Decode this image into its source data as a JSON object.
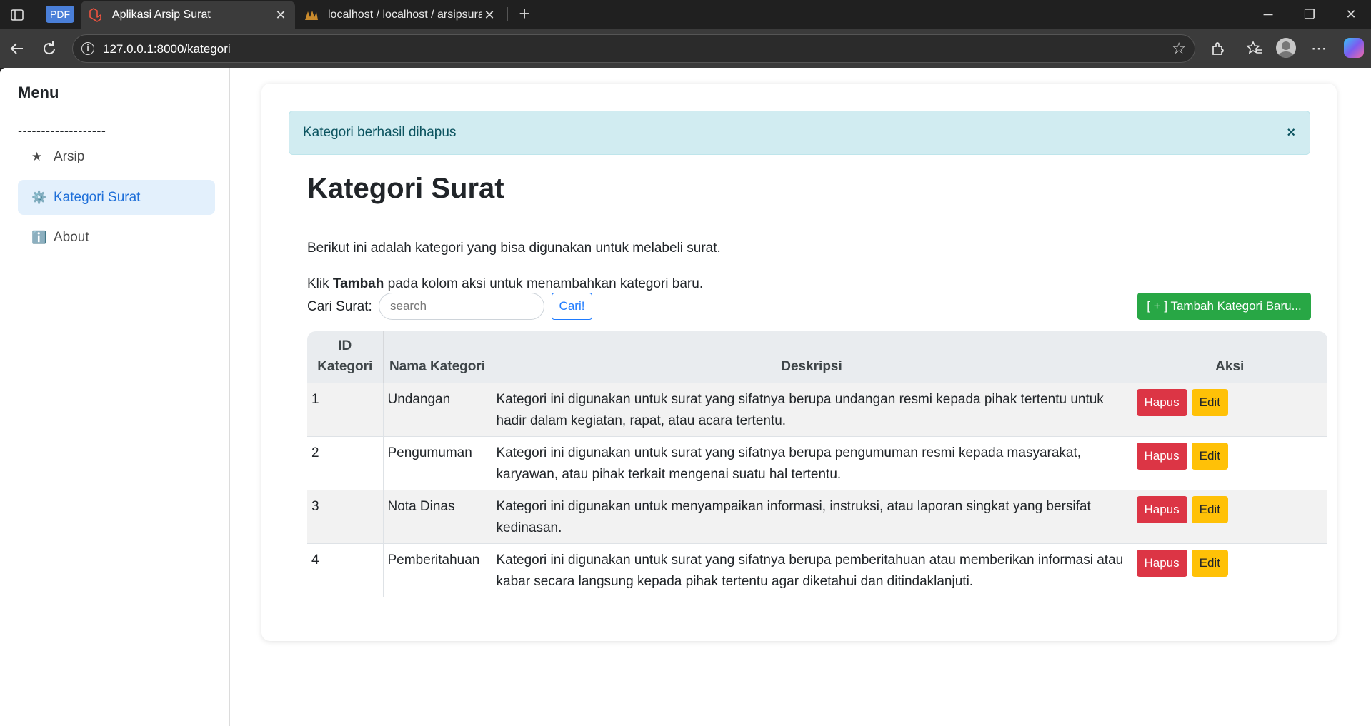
{
  "browser": {
    "pdf_badge": "PDF",
    "tabs": [
      {
        "title": "Aplikasi Arsip Surat",
        "active": true,
        "favicon": "laravel-icon"
      },
      {
        "title": "localhost / localhost / arsipsurat_l",
        "active": false,
        "favicon": "phpmyadmin-icon"
      }
    ],
    "url": "127.0.0.1:8000/kategori"
  },
  "sidebar": {
    "title": "Menu",
    "divider": "-------------------",
    "items": [
      {
        "icon": "★",
        "icon_name": "star-icon",
        "label": "Arsip",
        "active": false
      },
      {
        "icon": "⚙️",
        "icon_name": "gear-icon",
        "label": "Kategori Surat",
        "active": true
      },
      {
        "icon": "ℹ️",
        "icon_name": "info-icon",
        "label": "About",
        "active": false
      }
    ]
  },
  "main": {
    "alert": "Kategori berhasil dihapus",
    "alert_close": "×",
    "title": "Kategori Surat",
    "intro": "Berikut ini adalah kategori yang bisa digunakan untuk melabeli surat.",
    "hint_prefix": "Klik",
    "hint_bold": "Tambah",
    "hint_suffix": "pada kolom aksi untuk menambahkan kategori baru.",
    "search_label": "Cari Surat:",
    "search_placeholder": "search",
    "search_button": "Cari!",
    "add_button": "[ + ] Tambah Kategori Baru...",
    "table": {
      "headers": [
        "ID Kategori",
        "Nama Kategori",
        "Deskripsi",
        "Aksi"
      ],
      "rows": [
        {
          "id": "1",
          "nama": "Undangan",
          "deskripsi": "Kategori ini digunakan untuk surat yang sifatnya berupa undangan resmi kepada pihak tertentu untuk hadir dalam kegiatan, rapat, atau acara tertentu."
        },
        {
          "id": "2",
          "nama": "Pengumuman",
          "deskripsi": "Kategori ini digunakan untuk surat yang sifatnya berupa pengumuman resmi kepada masyarakat, karyawan, atau pihak terkait mengenai suatu hal tertentu."
        },
        {
          "id": "3",
          "nama": "Nota Dinas",
          "deskripsi": "Kategori ini digunakan untuk menyampaikan informasi, instruksi, atau laporan singkat yang bersifat kedinasan."
        },
        {
          "id": "4",
          "nama": "Pemberitahuan",
          "deskripsi": "Kategori ini digunakan untuk surat yang sifatnya berupa pemberitahuan atau memberikan informasi atau kabar secara langsung kepada pihak tertentu agar diketahui dan ditindaklanjuti."
        }
      ],
      "delete_label": "Hapus",
      "edit_label": "Edit"
    }
  },
  "colors": {
    "success": "#28a745",
    "danger": "#dc3545",
    "warning": "#ffc107",
    "info_bg": "#d1ecf1",
    "primary": "#1e7bff"
  }
}
